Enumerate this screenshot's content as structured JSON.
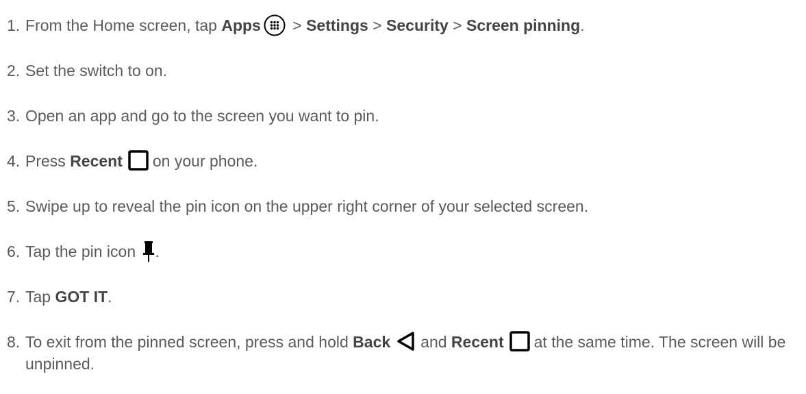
{
  "steps": [
    {
      "number": "1.",
      "t1": "From the Home screen, tap ",
      "b1": "Apps",
      "icon1": "apps-grid-icon",
      "t2": " > ",
      "b2": "Settings",
      "t3": " > ",
      "b3": "Security",
      "t4": " > ",
      "b4": "Screen pinning",
      "t5": "."
    },
    {
      "number": "2.",
      "t1": "Set the switch to on."
    },
    {
      "number": "3.",
      "t1": "Open an app and go to the screen you want to pin."
    },
    {
      "number": "4.",
      "t1": "Press ",
      "b1": "Recent",
      "icon1": "recent-square-icon",
      "t2": "on your phone."
    },
    {
      "number": "5.",
      "t1": "Swipe up to reveal the pin icon on the upper right corner of your selected screen."
    },
    {
      "number": "6.",
      "t1": "Tap the pin icon",
      "icon1": "pin-icon",
      "t2": "."
    },
    {
      "number": "7.",
      "t1": "Tap ",
      "b1": "GOT IT",
      "t2": "."
    },
    {
      "number": "8.",
      "t1": "To exit from the pinned screen, press and hold ",
      "b1": "Back",
      "icon1": "back-triangle-icon",
      "t2": "and ",
      "b2": "Recent",
      "icon2": "recent-square-icon",
      "t3": "at the same time. The screen will be unpinned."
    }
  ]
}
